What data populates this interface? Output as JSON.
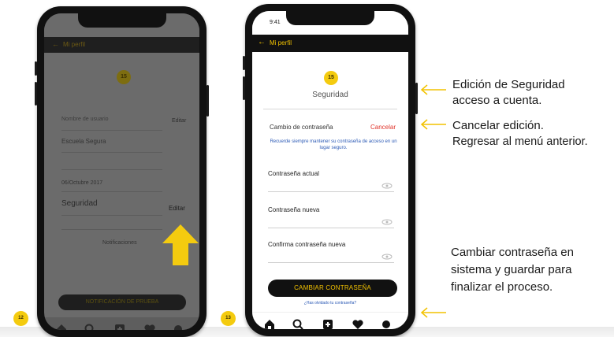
{
  "phone1": {
    "status_time": "",
    "status_right": "",
    "header_back": "←",
    "header_title": "Mi perfil",
    "badge": "15",
    "subtitle": "",
    "username_label": "Nombre de usuario",
    "username_value": "Escuela Segura",
    "edit_label": "Editar",
    "date_value": "06/Octubre 2017",
    "security_label": "Seguridad",
    "security_edit_label": "Editar",
    "notifications_label": "Notificaciones",
    "note_text": "",
    "pill_label": "NOTIFICACIÓN DE PRUEBA"
  },
  "phone2": {
    "status_time": "9:41",
    "status_right": "",
    "header_back": "←",
    "header_title": "Mi perfil",
    "badge": "15",
    "title": "Seguridad",
    "change_label": "Cambio de contraseña",
    "cancel_label": "Cancelar",
    "info_text": "Recuerde siempre mantener su contraseña de acceso en un lugar seguro.",
    "current_label": "Contraseña actual",
    "current_placeholder": "",
    "new_label": "Contraseña nueva",
    "new_placeholder": "",
    "confirm_label": "Confirma contraseña nueva",
    "confirm_placeholder": "",
    "save_button": "CAMBIAR CONTRASEÑA",
    "forgot_link": "¿Has olvidado tu contraseña?"
  },
  "steps": {
    "left": "12",
    "right": "13"
  },
  "callouts": {
    "edit_security_1": "Edición de Seguridad",
    "edit_security_2": "acceso a cuenta.",
    "cancel_1": "Cancelar edición.",
    "cancel_2": "Regresar al menú anterior.",
    "change_1": "Cambiar contraseña en",
    "change_2": "sistema y guardar para",
    "change_3": "finalizar el proceso."
  },
  "colors": {
    "accent_yellow": "#f4cb0f",
    "cancel_red": "#e0352b",
    "link_blue": "#2b59b5",
    "dark": "#111111",
    "dim": "#6b6b6b"
  },
  "icons": [
    "home-icon",
    "search-icon",
    "add-icon",
    "heart-icon",
    "profile-icon",
    "eye-icon",
    "arrow-left-icon",
    "arrow-up-icon"
  ]
}
